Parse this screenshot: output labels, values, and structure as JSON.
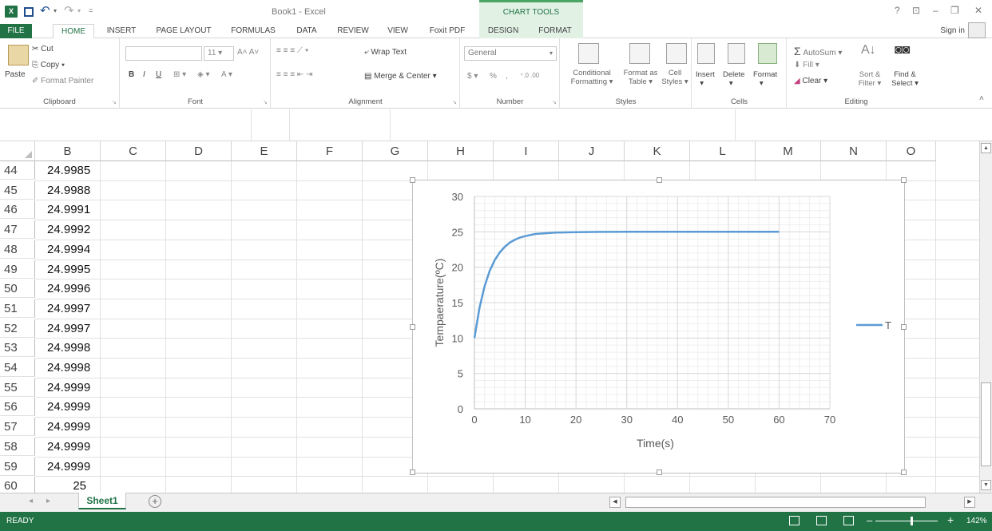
{
  "window": {
    "title": "Book1 - Excel",
    "context_tab": "CHART TOOLS",
    "help": "?",
    "sign_in": "Sign in"
  },
  "tabs": [
    "FILE",
    "HOME",
    "INSERT",
    "PAGE LAYOUT",
    "FORMULAS",
    "DATA",
    "REVIEW",
    "VIEW",
    "Foxit PDF",
    "DESIGN",
    "FORMAT"
  ],
  "ribbon": {
    "clipboard": {
      "paste": "Paste",
      "cut": "Cut",
      "copy": "Copy",
      "format_painter": "Format Painter",
      "label": "Clipboard"
    },
    "font": {
      "size": "11",
      "label": "Font",
      "bold": "B",
      "italic": "I",
      "underline": "U"
    },
    "alignment": {
      "wrap": "Wrap Text",
      "merge": "Merge & Center",
      "label": "Alignment"
    },
    "number": {
      "format": "General",
      "currency": "$",
      "percent": "%",
      "comma": ",",
      "label": "Number"
    },
    "styles": {
      "conditional": "Conditional",
      "conditional2": "Formatting",
      "format_as": "Format as",
      "format_as2": "Table",
      "cell": "Cell",
      "cell2": "Styles",
      "label": "Styles"
    },
    "cells": {
      "insert": "Insert",
      "delete": "Delete",
      "format": "Format",
      "label": "Cells"
    },
    "editing": {
      "autosum": "AutoSum",
      "fill": "Fill",
      "clear": "Clear",
      "sort": "Sort &",
      "sort2": "Filter",
      "find": "Find &",
      "find2": "Select",
      "label": "Editing"
    }
  },
  "columns": [
    "B",
    "C",
    "D",
    "E",
    "F",
    "G",
    "H",
    "I",
    "J",
    "K",
    "L",
    "M",
    "N",
    "O"
  ],
  "rows": [
    {
      "num": "44",
      "b": "24.9985"
    },
    {
      "num": "45",
      "b": "24.9988"
    },
    {
      "num": "46",
      "b": "24.9991"
    },
    {
      "num": "47",
      "b": "24.9992"
    },
    {
      "num": "48",
      "b": "24.9994"
    },
    {
      "num": "49",
      "b": "24.9995"
    },
    {
      "num": "50",
      "b": "24.9996"
    },
    {
      "num": "51",
      "b": "24.9997"
    },
    {
      "num": "52",
      "b": "24.9997"
    },
    {
      "num": "53",
      "b": "24.9998"
    },
    {
      "num": "54",
      "b": "24.9998"
    },
    {
      "num": "55",
      "b": "24.9999"
    },
    {
      "num": "56",
      "b": "24.9999"
    },
    {
      "num": "57",
      "b": "24.9999"
    },
    {
      "num": "58",
      "b": "24.9999"
    },
    {
      "num": "59",
      "b": "24.9999"
    },
    {
      "num": "60",
      "b": "25"
    }
  ],
  "chart_data": {
    "type": "line",
    "xlabel": "Time(s)",
    "ylabel": "Tempaerature(ºC)",
    "xlim": [
      0,
      70
    ],
    "ylim": [
      0,
      30
    ],
    "xticks": [
      "0",
      "10",
      "20",
      "30",
      "40",
      "50",
      "60",
      "70"
    ],
    "yticks": [
      "0",
      "5",
      "10",
      "15",
      "20",
      "25",
      "30"
    ],
    "grid": true,
    "legend": "right",
    "series": [
      {
        "name": "T",
        "color": "#5b9bd5",
        "x": [
          0,
          1,
          2,
          3,
          4,
          5,
          6,
          7,
          8,
          9,
          10,
          12,
          14,
          16,
          18,
          20,
          25,
          30,
          35,
          40,
          45,
          50,
          55,
          60
        ],
        "y": [
          10,
          14.3,
          17.3,
          19.5,
          21.0,
          22.1,
          22.9,
          23.5,
          23.9,
          24.2,
          24.4,
          24.7,
          24.8,
          24.9,
          24.93,
          24.96,
          24.99,
          25,
          25,
          25,
          25,
          25,
          25,
          25
        ]
      }
    ]
  },
  "sheets": [
    "Sheet1"
  ],
  "status": {
    "ready": "READY",
    "zoom": "142%"
  }
}
